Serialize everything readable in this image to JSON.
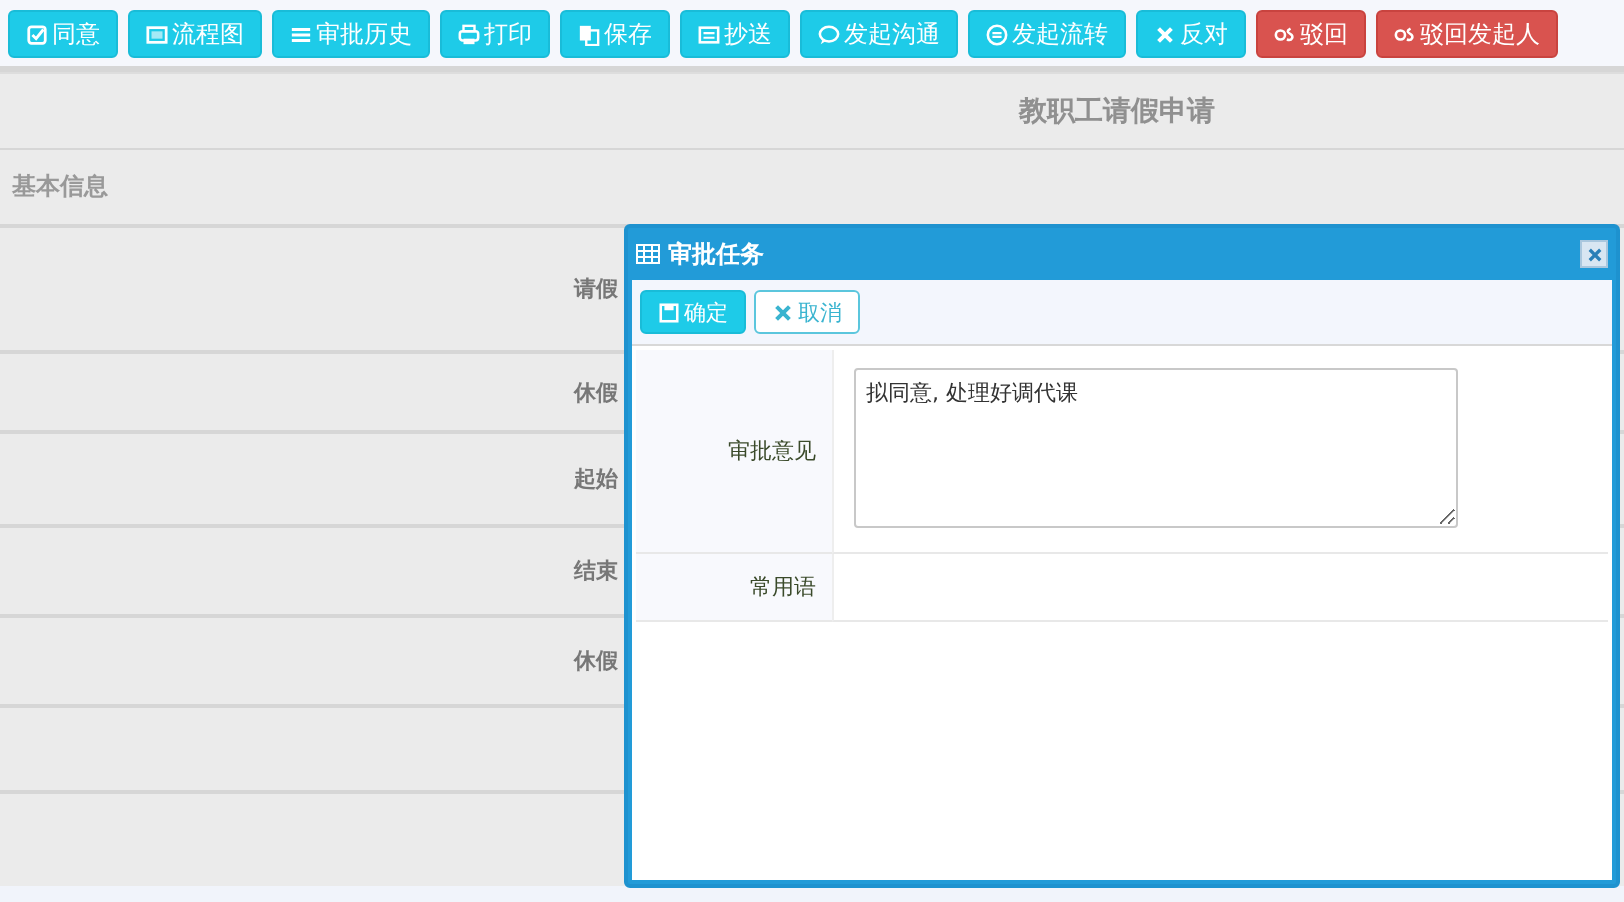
{
  "toolbar": [
    {
      "label": "同意",
      "kind": "primary"
    },
    {
      "label": "流程图",
      "kind": "primary"
    },
    {
      "label": "审批历史",
      "kind": "primary"
    },
    {
      "label": "打印",
      "kind": "primary"
    },
    {
      "label": "保存",
      "kind": "primary"
    },
    {
      "label": "抄送",
      "kind": "primary"
    },
    {
      "label": "发起沟通",
      "kind": "primary"
    },
    {
      "label": "发起流转",
      "kind": "primary"
    },
    {
      "label": "反对",
      "kind": "primary"
    },
    {
      "label": "驳回",
      "kind": "danger"
    },
    {
      "label": "驳回发起人",
      "kind": "danger"
    }
  ],
  "form": {
    "title": "教职工请假申请",
    "section": "基本信息",
    "rows": [
      {
        "label": "请假"
      },
      {
        "label": "休假"
      },
      {
        "label": "起始"
      },
      {
        "label": "结束"
      },
      {
        "label": "休假"
      },
      {},
      {}
    ]
  },
  "dialog": {
    "title": "审批任务",
    "buttons": [
      {
        "label": "确定",
        "kind": "primary"
      },
      {
        "label": "取消",
        "kind": "outline"
      }
    ],
    "fields": [
      {
        "label": "审批意见",
        "kind": "textarea",
        "value": "拟同意, 处理好调代课"
      },
      {
        "label": "常用语",
        "kind": "empty"
      }
    ]
  }
}
